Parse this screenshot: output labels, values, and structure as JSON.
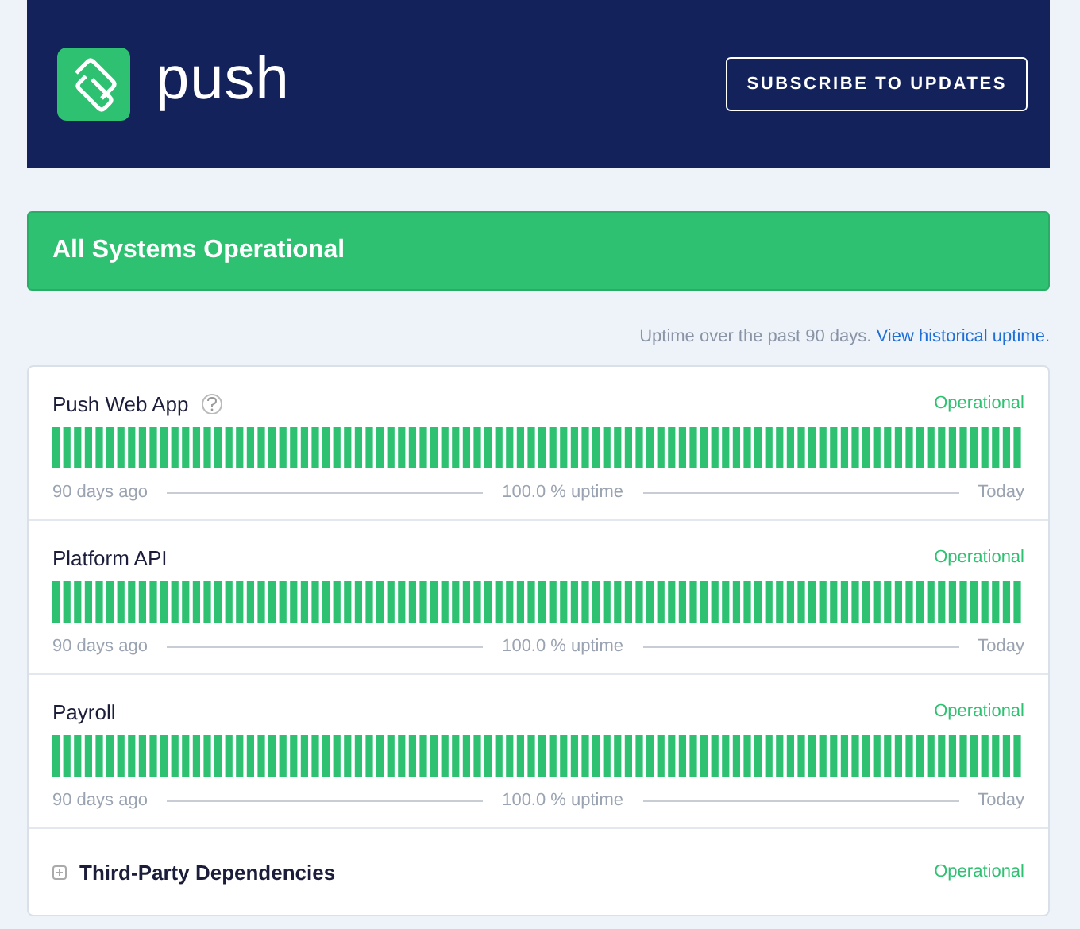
{
  "header": {
    "logo_text": "push",
    "subscribe_button": "SUBSCRIBE TO UPDATES"
  },
  "status_banner": {
    "text": "All Systems Operational"
  },
  "uptime_note": {
    "text": "Uptime over the past 90 days.",
    "link": "View historical uptime."
  },
  "components": [
    {
      "kind": "component",
      "name": "Push Web App",
      "help": true,
      "status": "Operational",
      "left_label": "90 days ago",
      "uptime": "100.0 % uptime",
      "right_label": "Today"
    },
    {
      "kind": "component",
      "name": "Platform API",
      "help": false,
      "status": "Operational",
      "left_label": "90 days ago",
      "uptime": "100.0 % uptime",
      "right_label": "Today"
    },
    {
      "kind": "component",
      "name": "Payroll",
      "help": false,
      "status": "Operational",
      "left_label": "90 days ago",
      "uptime": "100.0 % uptime",
      "right_label": "Today"
    },
    {
      "kind": "group",
      "name": "Third-Party Dependencies",
      "expanded": false,
      "status": "Operational"
    }
  ]
}
